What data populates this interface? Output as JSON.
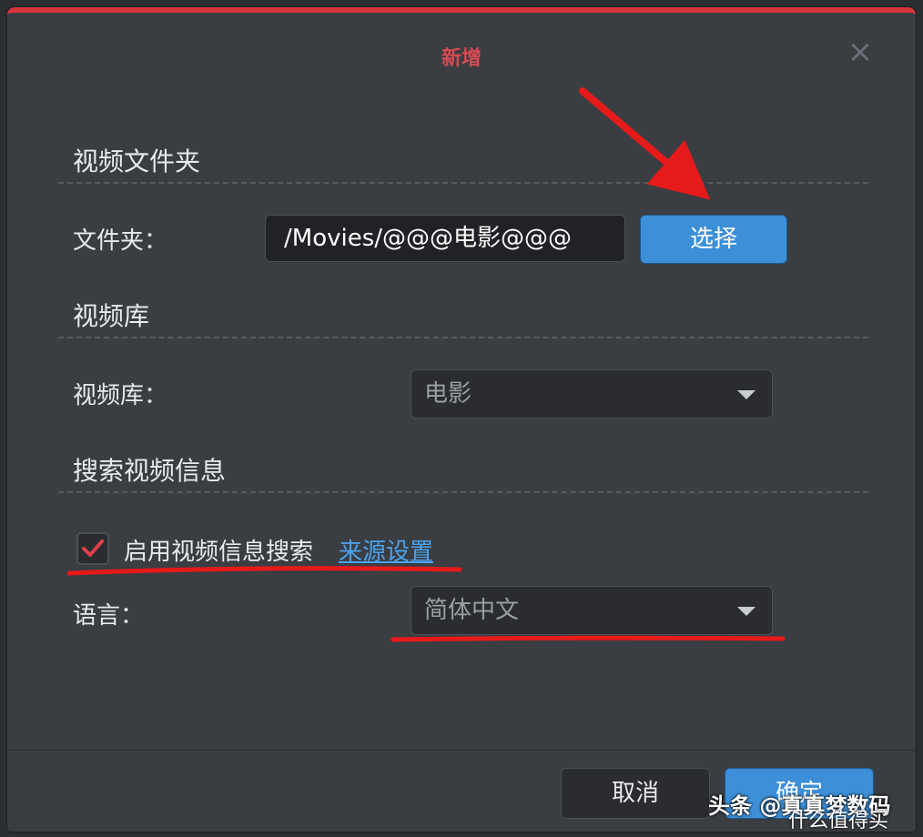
{
  "dialog": {
    "title": "新增",
    "close_icon": "close-icon",
    "accent_color": "#d8353f"
  },
  "folder_section": {
    "heading": "视频文件夹",
    "label": "文件夹：",
    "value": "/Movies/@@@电影@@@",
    "choose_label": "选择"
  },
  "library_section": {
    "heading": "视频库",
    "label": "视频库：",
    "selected": "电影"
  },
  "search_section": {
    "heading": "搜索视频信息",
    "checkbox_checked": true,
    "checkbox_label": "启用视频信息搜索",
    "source_link": "来源设置",
    "language_label": "语言：",
    "language_selected": "简体中文"
  },
  "footer": {
    "cancel_label": "取消",
    "ok_label": "确定"
  },
  "watermark": {
    "line1": "头条 @真真梦数码",
    "line2": "什么值得买"
  }
}
